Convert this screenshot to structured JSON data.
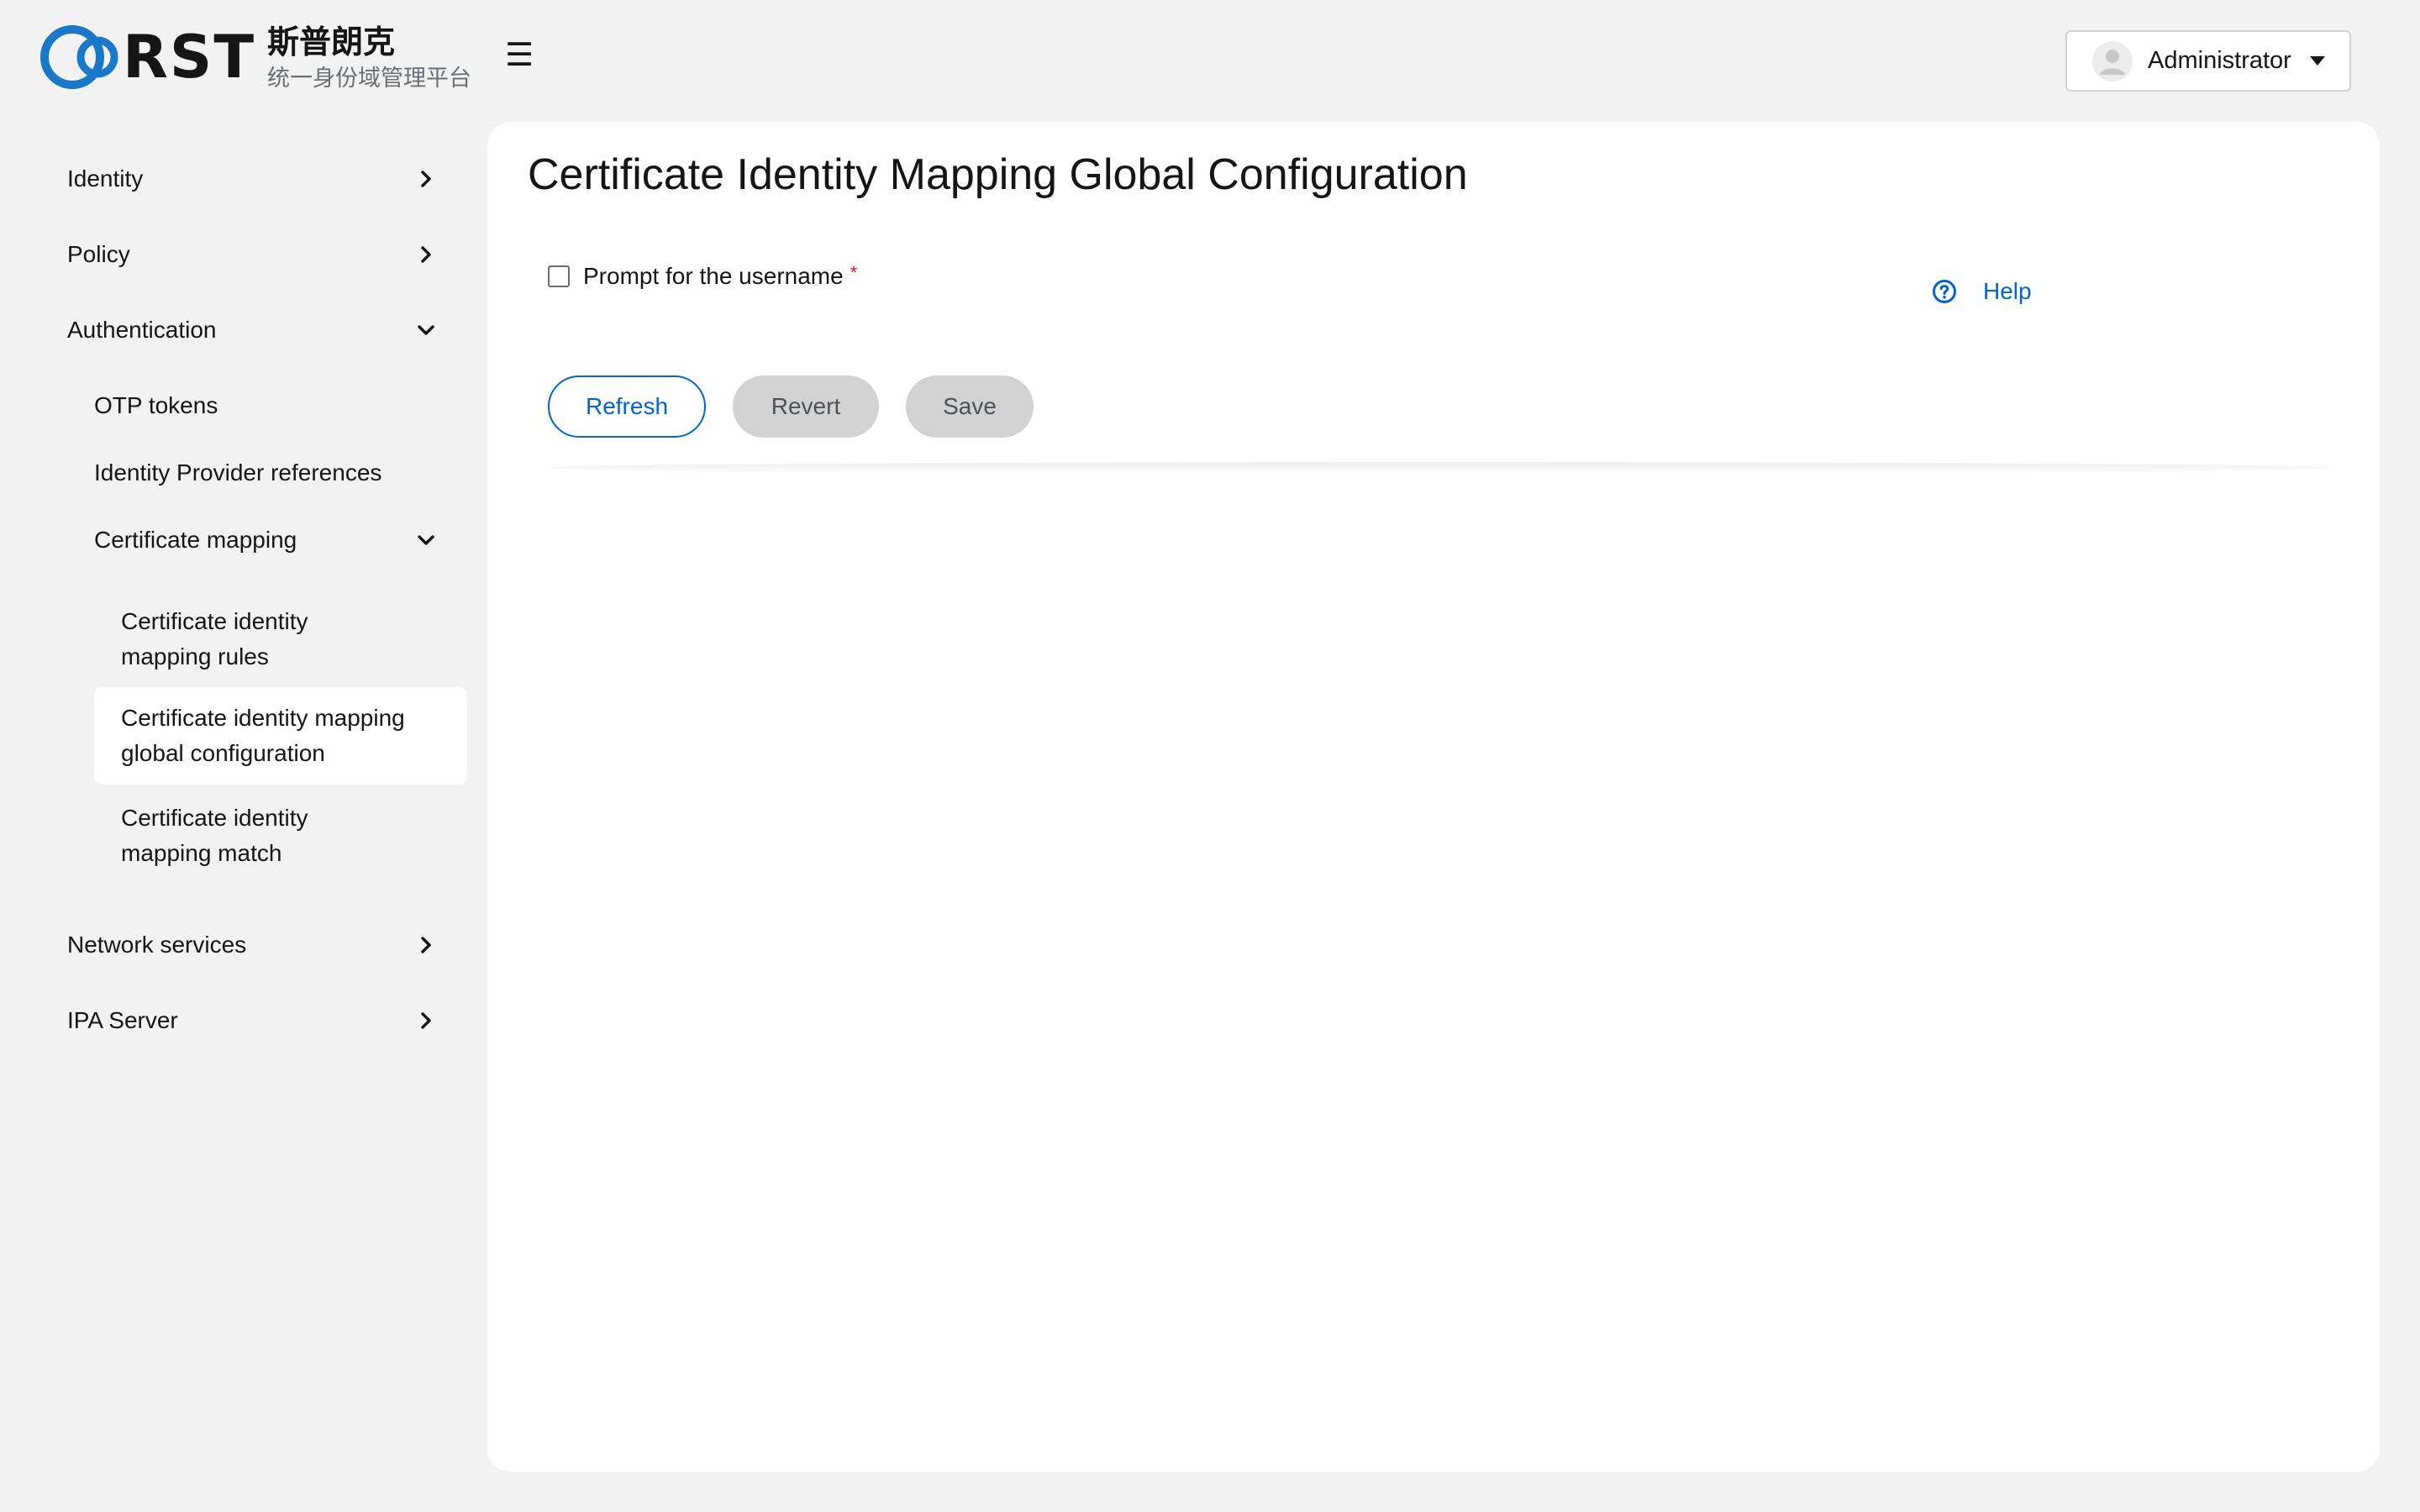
{
  "brand": {
    "logo_text": "RST",
    "title": "斯普朗克",
    "subtitle": "统一身份域管理平台"
  },
  "header": {
    "user_label": "Administrator"
  },
  "sidebar": {
    "items": [
      {
        "label": "Identity"
      },
      {
        "label": "Policy"
      },
      {
        "label": "Authentication"
      },
      {
        "label": "OTP tokens"
      },
      {
        "label": "Identity Provider references"
      },
      {
        "label": "Certificate mapping"
      },
      {
        "label": "Certificate identity mapping rules"
      },
      {
        "label": "Certificate identity mapping global configuration"
      },
      {
        "label": "Certificate identity mapping match"
      },
      {
        "label": "Network services"
      },
      {
        "label": "IPA Server"
      }
    ]
  },
  "main": {
    "title": "Certificate Identity Mapping Global Configuration",
    "field": {
      "label": "Prompt for the username",
      "required_mark": "*",
      "checked": false
    },
    "help_label": "Help",
    "buttons": {
      "refresh": "Refresh",
      "revert": "Revert",
      "save": "Save"
    }
  },
  "colors": {
    "accent": "#0066cc",
    "background": "#f2f2f2",
    "panel": "#ffffff",
    "disabled_button": "#d2d2d2",
    "required": "#c9190b"
  },
  "icons": [
    "rst-logo-icon",
    "hamburger-icon",
    "avatar-icon",
    "caret-down-icon",
    "chevron-right-icon",
    "chevron-down-icon",
    "help-circle-icon",
    "checkbox-icon"
  ]
}
